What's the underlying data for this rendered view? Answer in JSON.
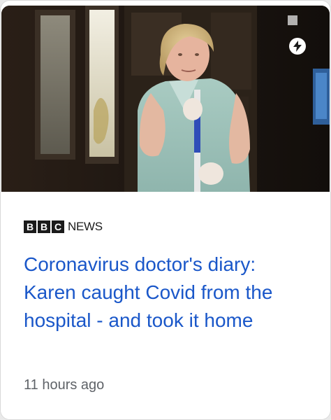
{
  "article": {
    "image_alt": "Karen, a hospital cleaner in a light green uniform holding a mop handle",
    "source": {
      "logo_letters": [
        "B",
        "B",
        "C"
      ],
      "name": "NEWS"
    },
    "headline": "Coronavirus doctor's diary: Karen caught Covid from the hospital - and took it home",
    "timestamp": "11 hours ago",
    "badge_icon": "lightning-bolt-icon"
  },
  "colors": {
    "headline": "#1a57c9",
    "timestamp": "#5f6368",
    "logo": "#1b1b1b",
    "card_background": "#ffffff"
  }
}
